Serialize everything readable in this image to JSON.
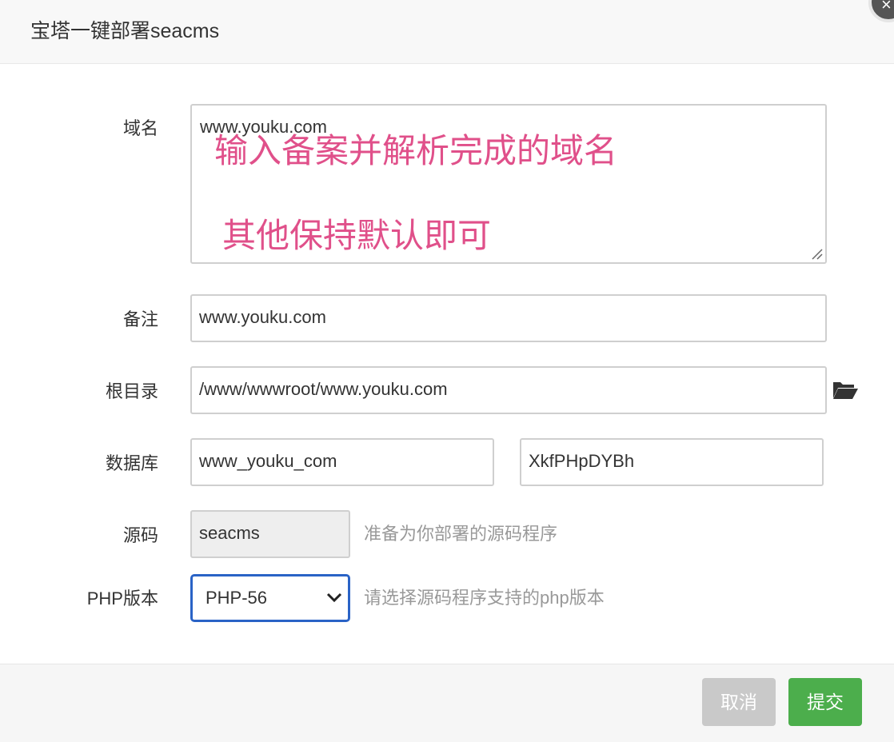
{
  "dialog": {
    "title": "宝塔一键部署seacms",
    "close_glyph": "×"
  },
  "form": {
    "domain": {
      "label": "域名",
      "value": "www.youku.com",
      "note_line1": "输入备案并解析完成的域名",
      "note_line2": "其他保持默认即可",
      "note_color": "#e0508a"
    },
    "remark": {
      "label": "备注",
      "value": "www.youku.com"
    },
    "root_dir": {
      "label": "根目录",
      "value": "/www/wwwroot/www.youku.com",
      "icon": "folder-open-icon"
    },
    "database": {
      "label": "数据库",
      "name_value": "www_youku_com",
      "password_value": "XkfPHpDYBh"
    },
    "source": {
      "label": "源码",
      "value": "seacms",
      "hint": "准备为你部署的源码程序"
    },
    "php": {
      "label": "PHP版本",
      "selected": "PHP-56",
      "hint": "请选择源码程序支持的php版本",
      "focus_color": "#2a63c6"
    }
  },
  "footer": {
    "cancel_label": "取消",
    "submit_label": "提交",
    "submit_color": "#4cae4c"
  }
}
